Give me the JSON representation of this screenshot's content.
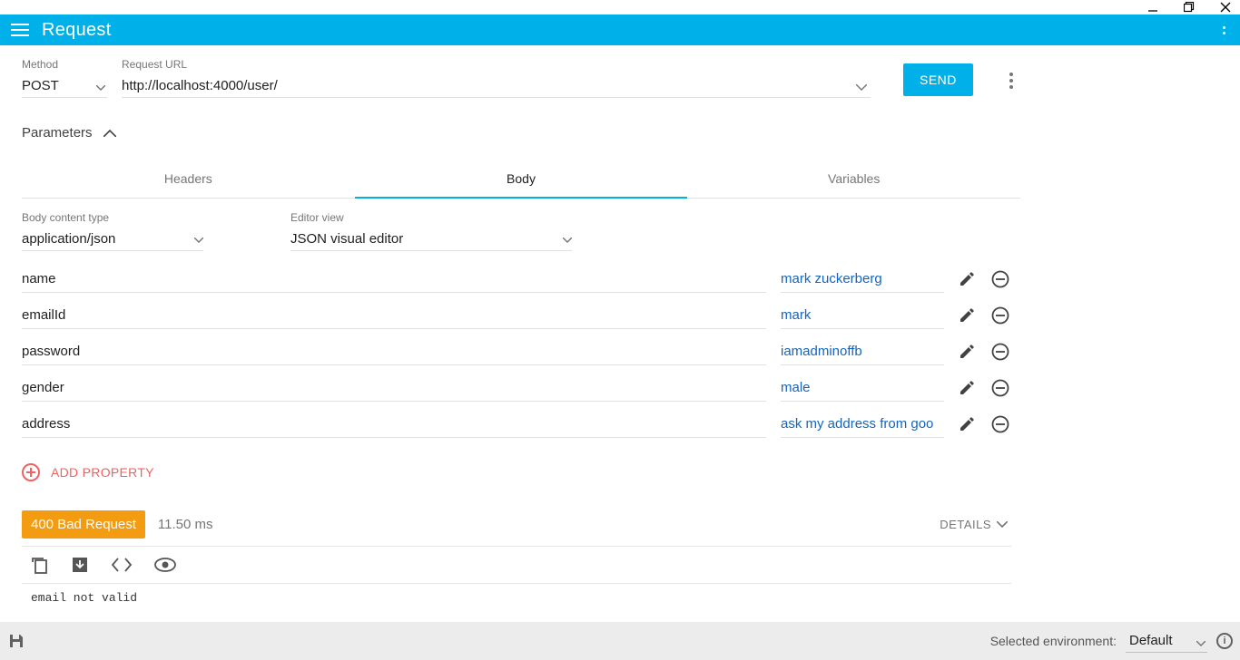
{
  "app": {
    "title": "Request"
  },
  "request": {
    "method_label": "Method",
    "method_value": "POST",
    "url_label": "Request URL",
    "url_value": "http://localhost:4000/user/",
    "send_label": "SEND"
  },
  "parameters": {
    "label": "Parameters"
  },
  "tabs": {
    "headers": "Headers",
    "body": "Body",
    "variables": "Variables",
    "active": "body"
  },
  "body_config": {
    "content_type_label": "Body content type",
    "content_type_value": "application/json",
    "editor_view_label": "Editor view",
    "editor_view_value": "JSON visual editor"
  },
  "json_body": {
    "rows": [
      {
        "key": "name",
        "value": "mark zuckerberg"
      },
      {
        "key": "emailId",
        "value": "mark"
      },
      {
        "key": "password",
        "value": "iamadminoffb"
      },
      {
        "key": "gender",
        "value": "male"
      },
      {
        "key": "address",
        "value": "ask my address from goo"
      }
    ],
    "add_label": "ADD PROPERTY"
  },
  "response": {
    "status_text": "400 Bad Request",
    "time_text": "11.50 ms",
    "details_label": "DETAILS",
    "body_text": "email not valid"
  },
  "statusbar": {
    "env_label": "Selected environment:",
    "env_value": "Default"
  }
}
